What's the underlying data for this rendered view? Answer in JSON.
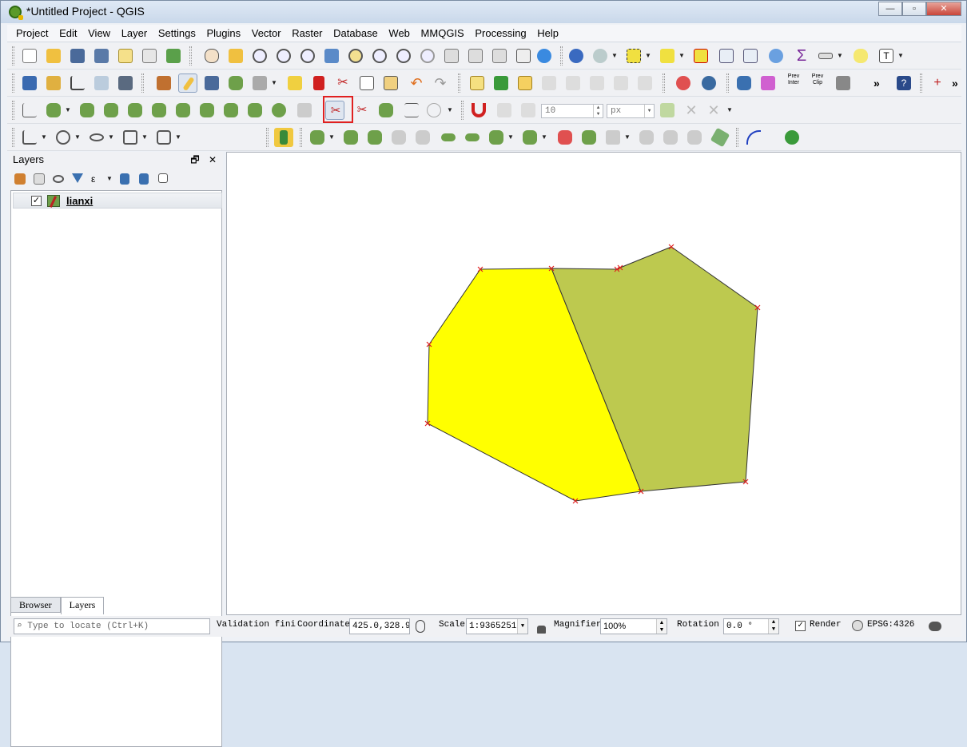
{
  "window": {
    "title": "*Untitled Project - QGIS"
  },
  "menu": [
    "Project",
    "Edit",
    "View",
    "Layer",
    "Settings",
    "Plugins",
    "Vector",
    "Raster",
    "Database",
    "Web",
    "MMQGIS",
    "Processing",
    "Help"
  ],
  "toolbar": {
    "segment_count": "10",
    "unit": "px",
    "preview_inter": "Prev Inter",
    "preview_clip": "Prev Clip"
  },
  "layers_panel": {
    "title": "Layers",
    "float_btn": "🗗",
    "close_btn": "✕",
    "layers": [
      {
        "name": "lianxi",
        "checked": true
      }
    ],
    "tabs": [
      "Browser",
      "Layers"
    ]
  },
  "status": {
    "locate_placeholder": "Type to locate (Ctrl+K)",
    "message": "Validation fini",
    "coordinate_label": "Coordinate",
    "coordinate_value": "425.0,328.9",
    "scale_label": "Scale",
    "scale_value": "1:9365251",
    "magnifier_label": "Magnifier",
    "magnifier_value": "100%",
    "rotation_label": "Rotation",
    "rotation_value": "0.0 °",
    "render_label": "Render",
    "crs": "EPSG:4326"
  },
  "map": {
    "features": [
      {
        "name": "yellow-polygon",
        "fill": "#ffff00"
      },
      {
        "name": "olive-polygon",
        "fill": "#bdc94f"
      }
    ],
    "vertex_color": "#e02020"
  }
}
